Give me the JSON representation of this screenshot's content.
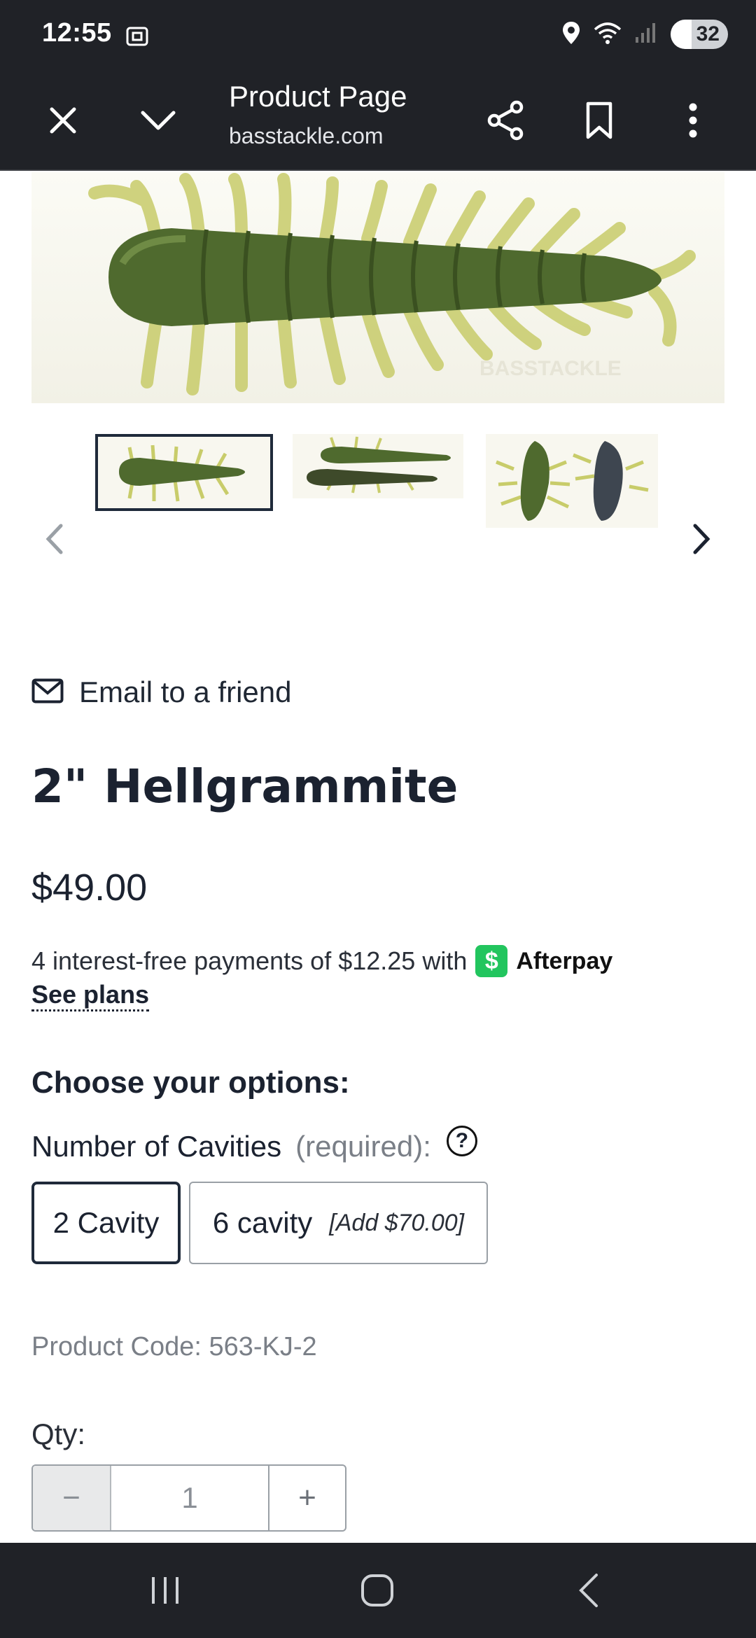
{
  "status_bar": {
    "time": "12:55",
    "battery": "32",
    "icons": [
      "screenshot-icon",
      "location-icon",
      "wifi-icon",
      "signal-icon",
      "battery-icon"
    ]
  },
  "browser": {
    "title": "Product Page",
    "url": "basstackle.com",
    "icons": [
      "close-icon",
      "chevron-down-icon",
      "share-icon",
      "bookmark-icon",
      "more-icon"
    ]
  },
  "gallery": {
    "watermark": "BASSTACKLE",
    "thumbnail_count": 3,
    "active_thumbnail": 1
  },
  "product": {
    "email_link": "Email to a friend",
    "title": "2\" Hellgrammite",
    "price": "$49.00",
    "afterpay_text": "4 interest-free payments of $12.25 with",
    "afterpay_symbol": "$",
    "afterpay_name": "Afterpay",
    "see_plans": "See plans",
    "choose_options": "Choose your options:",
    "option_name": "Number of Cavities",
    "option_required": "(required):",
    "help_symbol": "?",
    "options": [
      {
        "label": "2 Cavity",
        "addon": "",
        "selected": true
      },
      {
        "label": "6 cavity",
        "addon": "[Add $70.00]",
        "selected": false
      }
    ],
    "product_code": "Product Code: 563-KJ-2",
    "qty_label": "Qty:",
    "qty_value": "1",
    "qty_minus": "−",
    "qty_plus": "+"
  },
  "colors": {
    "chrome": "#202227",
    "afterpay_green": "#22c55e",
    "text_dark": "#1b2230",
    "muted": "#7a7f87"
  }
}
